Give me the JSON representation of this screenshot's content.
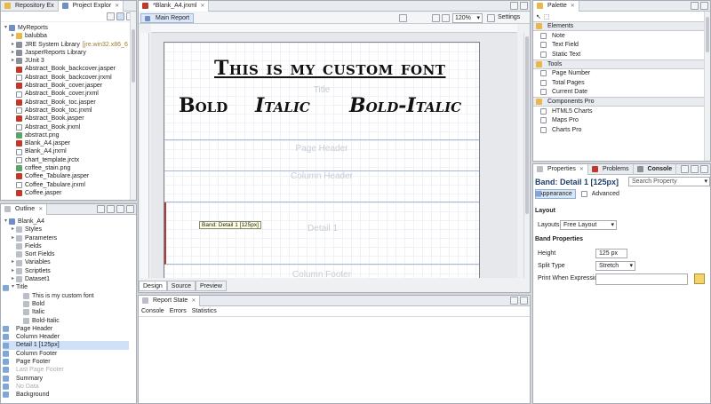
{
  "repo_panel": {
    "tabs": [
      {
        "label": "Repository Ex"
      },
      {
        "label": "Project Explor"
      }
    ],
    "items": [
      {
        "label": "MyReports",
        "indent": 0,
        "icon": "proj",
        "twisty": "▾"
      },
      {
        "label": "balubba",
        "indent": 1,
        "icon": "folder",
        "twisty": "▸"
      },
      {
        "label": "JRE System Library",
        "extra": "[jre.win32.x86_6",
        "indent": 1,
        "icon": "lib",
        "twisty": "▸"
      },
      {
        "label": "JasperReports Library",
        "indent": 1,
        "icon": "lib",
        "twisty": "▸"
      },
      {
        "label": "JUnit 3",
        "indent": 1,
        "icon": "lib",
        "twisty": "▸"
      },
      {
        "label": "Abstract_Book_backcover.jasper",
        "indent": 1,
        "icon": "jasper"
      },
      {
        "label": "Abstract_Book_backcover.jrxml",
        "indent": 1,
        "icon": "file"
      },
      {
        "label": "Abstract_Book_cover.jasper",
        "indent": 1,
        "icon": "jasper"
      },
      {
        "label": "Abstract_Book_cover.jrxml",
        "indent": 1,
        "icon": "file"
      },
      {
        "label": "Abstract_Book_toc.jasper",
        "indent": 1,
        "icon": "jasper"
      },
      {
        "label": "Abstract_Book_toc.jrxml",
        "indent": 1,
        "icon": "file"
      },
      {
        "label": "Abstract_Book.jasper",
        "indent": 1,
        "icon": "jasper"
      },
      {
        "label": "Abstract_Book.jrxml",
        "indent": 1,
        "icon": "file"
      },
      {
        "label": "abstract.png",
        "indent": 1,
        "icon": "img"
      },
      {
        "label": "Blank_A4.jasper",
        "indent": 1,
        "icon": "jasper"
      },
      {
        "label": "Blank_A4.jrxml",
        "indent": 1,
        "icon": "file"
      },
      {
        "label": "chart_template.jrctx",
        "indent": 1,
        "icon": "file"
      },
      {
        "label": "coffee_stain.png",
        "indent": 1,
        "icon": "img"
      },
      {
        "label": "Coffee_Tabulare.jasper",
        "indent": 1,
        "icon": "jasper"
      },
      {
        "label": "Coffee_Tabulare.jrxml",
        "indent": 1,
        "icon": "file"
      },
      {
        "label": "Coffee.jasper",
        "indent": 1,
        "icon": "jasper"
      }
    ]
  },
  "outline_panel": {
    "tab": "Outline",
    "items": [
      {
        "label": "Blank_A4",
        "indent": 0,
        "icon": "proj",
        "twisty": "▾"
      },
      {
        "label": "Styles",
        "indent": 1,
        "icon": "elem",
        "twisty": "▸"
      },
      {
        "label": "Parameters",
        "indent": 1,
        "icon": "elem",
        "twisty": "▸"
      },
      {
        "label": "Fields",
        "indent": 1,
        "icon": "elem"
      },
      {
        "label": "Sort Fields",
        "indent": 1,
        "icon": "elem"
      },
      {
        "label": "Variables",
        "indent": 1,
        "icon": "elem",
        "twisty": "▸"
      },
      {
        "label": "Scriptlets",
        "indent": 1,
        "icon": "elem",
        "twisty": "▸"
      },
      {
        "label": "Dataset1",
        "indent": 1,
        "icon": "elem",
        "twisty": "▸"
      },
      {
        "label": "Title",
        "indent": 1,
        "icon": "band",
        "twisty": "▾"
      },
      {
        "label": "This is my custom font",
        "indent": 2,
        "icon": "elem"
      },
      {
        "label": "Bold",
        "indent": 2,
        "icon": "elem"
      },
      {
        "label": "Italic",
        "indent": 2,
        "icon": "elem"
      },
      {
        "label": "Bold-Italic",
        "indent": 2,
        "icon": "elem"
      },
      {
        "label": "Page Header",
        "indent": 1,
        "icon": "band"
      },
      {
        "label": "Column Header",
        "indent": 1,
        "icon": "band"
      },
      {
        "label": "Detail 1 [125px]",
        "indent": 1,
        "icon": "band",
        "selected": true
      },
      {
        "label": "Column Footer",
        "indent": 1,
        "icon": "band"
      },
      {
        "label": "Page Footer",
        "indent": 1,
        "icon": "band"
      },
      {
        "label": "Last Page Footer",
        "indent": 1,
        "icon": "band",
        "muted": true
      },
      {
        "label": "Summary",
        "indent": 1,
        "icon": "band"
      },
      {
        "label": "No Data",
        "indent": 1,
        "icon": "band",
        "muted": true
      },
      {
        "label": "Background",
        "indent": 1,
        "icon": "band"
      }
    ]
  },
  "editor": {
    "file_tab": "*Blank_A4.jrxml",
    "main_tab": "Main Report",
    "zoom": "120%",
    "settings": "Settings",
    "bottom_tabs": [
      "Design",
      "Source",
      "Preview"
    ],
    "custom_title": "This is my custom font",
    "custom_styles": [
      "Bold",
      "Italic",
      "Bold-Italic"
    ],
    "bands": {
      "title": "Title",
      "page_header": "Page Header",
      "column_header": "Column Header",
      "detail": "Detail 1",
      "column_footer": "Column Footer"
    },
    "band_tooltip": "Band: Detail 1 [125px]"
  },
  "report_state": {
    "tab": "Report State",
    "tabs": [
      "Console",
      "Errors",
      "Statistics"
    ]
  },
  "palette": {
    "tab": "Palette",
    "sections": [
      {
        "label": "Elements",
        "items": [
          "Note",
          "Text Field",
          "Static Text"
        ]
      },
      {
        "label": "Tools",
        "items": [
          "Page Number",
          "Total Pages",
          "Current Date"
        ]
      },
      {
        "label": "Components Pro",
        "items": [
          "HTML5 Charts",
          "Maps Pro",
          "Charts Pro"
        ]
      }
    ]
  },
  "properties": {
    "tabs": [
      "Properties",
      "Problems",
      "Console"
    ],
    "title": "Band: Detail 1 [125px]",
    "search_placeholder": "Search Property",
    "subtabs": [
      "Appearance",
      "Advanced"
    ],
    "layout_head": "Layout",
    "layouts_label": "Layouts",
    "layouts_value": "Free Layout",
    "band_head": "Band Properties",
    "height_label": "Height",
    "height_value": "125 px",
    "split_label": "Split Type",
    "split_value": "Stretch",
    "print_label": "Print When Expression"
  }
}
